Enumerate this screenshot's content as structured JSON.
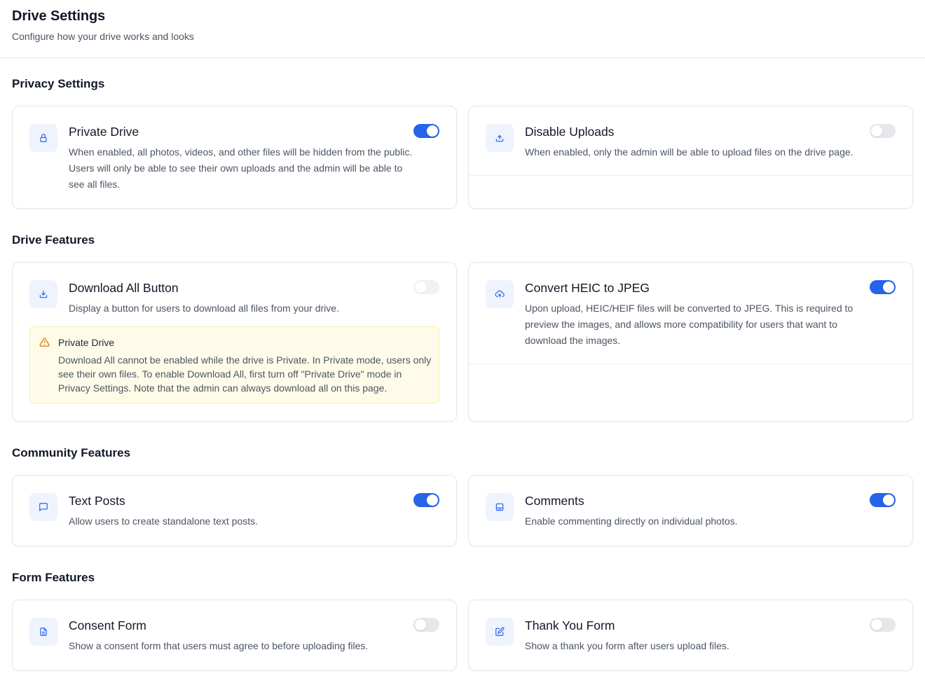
{
  "header": {
    "title": "Drive Settings",
    "subtitle": "Configure how your drive works and looks"
  },
  "sections": {
    "privacy": {
      "heading": "Privacy Settings",
      "private_drive": {
        "title": "Private Drive",
        "description": "When enabled, all photos, videos, and other files will be hidden from the public. Users will only be able to see their own uploads and the admin will be able to see all files.",
        "enabled": true,
        "icon": "lock-icon"
      },
      "disable_uploads": {
        "title": "Disable Uploads",
        "description": "When enabled, only the admin will be able to upload files on the drive page.",
        "enabled": false,
        "icon": "upload-icon"
      }
    },
    "drive_features": {
      "heading": "Drive Features",
      "download_all": {
        "title": "Download All Button",
        "description": "Display a button for users to download all files from your drive.",
        "enabled": false,
        "disabled": true,
        "icon": "download-icon",
        "warning": {
          "title": "Private Drive",
          "text": "Download All cannot be enabled while the drive is Private. In Private mode, users only see their own files. To enable Download All, first turn off \"Private Drive\" mode in Privacy Settings. Note that the admin can always download all on this page.",
          "icon": "warning-triangle-icon"
        }
      },
      "convert_heic": {
        "title": "Convert HEIC to JPEG",
        "description": "Upon upload, HEIC/HEIF files will be converted to JPEG. This is required to preview the images, and allows more compatibility for users that want to download the images.",
        "enabled": true,
        "icon": "cloud-convert-icon"
      }
    },
    "community": {
      "heading": "Community Features",
      "text_posts": {
        "title": "Text Posts",
        "description": "Allow users to create standalone text posts.",
        "enabled": true,
        "icon": "message-square-icon"
      },
      "comments": {
        "title": "Comments",
        "description": "Enable commenting directly on individual photos.",
        "enabled": true,
        "icon": "photo-comment-icon"
      }
    },
    "form": {
      "heading": "Form Features",
      "consent_form": {
        "title": "Consent Form",
        "description": "Show a consent form that users must agree to before uploading files.",
        "enabled": false,
        "icon": "file-text-icon"
      },
      "thank_you_form": {
        "title": "Thank You Form",
        "description": "Show a thank you form after users upload files.",
        "enabled": false,
        "icon": "edit-icon"
      }
    }
  },
  "colors": {
    "accent": "#2563eb",
    "toggle_off": "#e5e7eb",
    "warning_bg": "#fefce8",
    "warning_icon": "#d97706"
  }
}
